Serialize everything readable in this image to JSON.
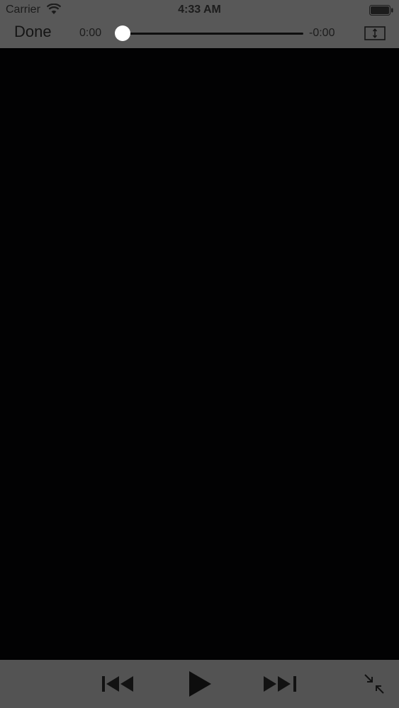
{
  "status_bar": {
    "carrier": "Carrier",
    "time": "4:33 AM",
    "wifi_icon": "wifi-icon",
    "battery_icon": "battery-icon"
  },
  "player": {
    "done_label": "Done",
    "time_elapsed": "0:00",
    "time_remaining": "-0:00",
    "playback_progress": 0,
    "aspect_icon": "aspect-ratio-icon"
  },
  "toolbar": {
    "prev_icon": "skip-back-icon",
    "play_icon": "play-icon",
    "next_icon": "skip-forward-icon",
    "minimize_icon": "minimize-icon"
  },
  "colors": {
    "panel_bg": "#585858",
    "toolbar_bg": "#535353",
    "video_bg": "#020203",
    "control_fg": "#151515",
    "thumb": "#ffffff"
  }
}
